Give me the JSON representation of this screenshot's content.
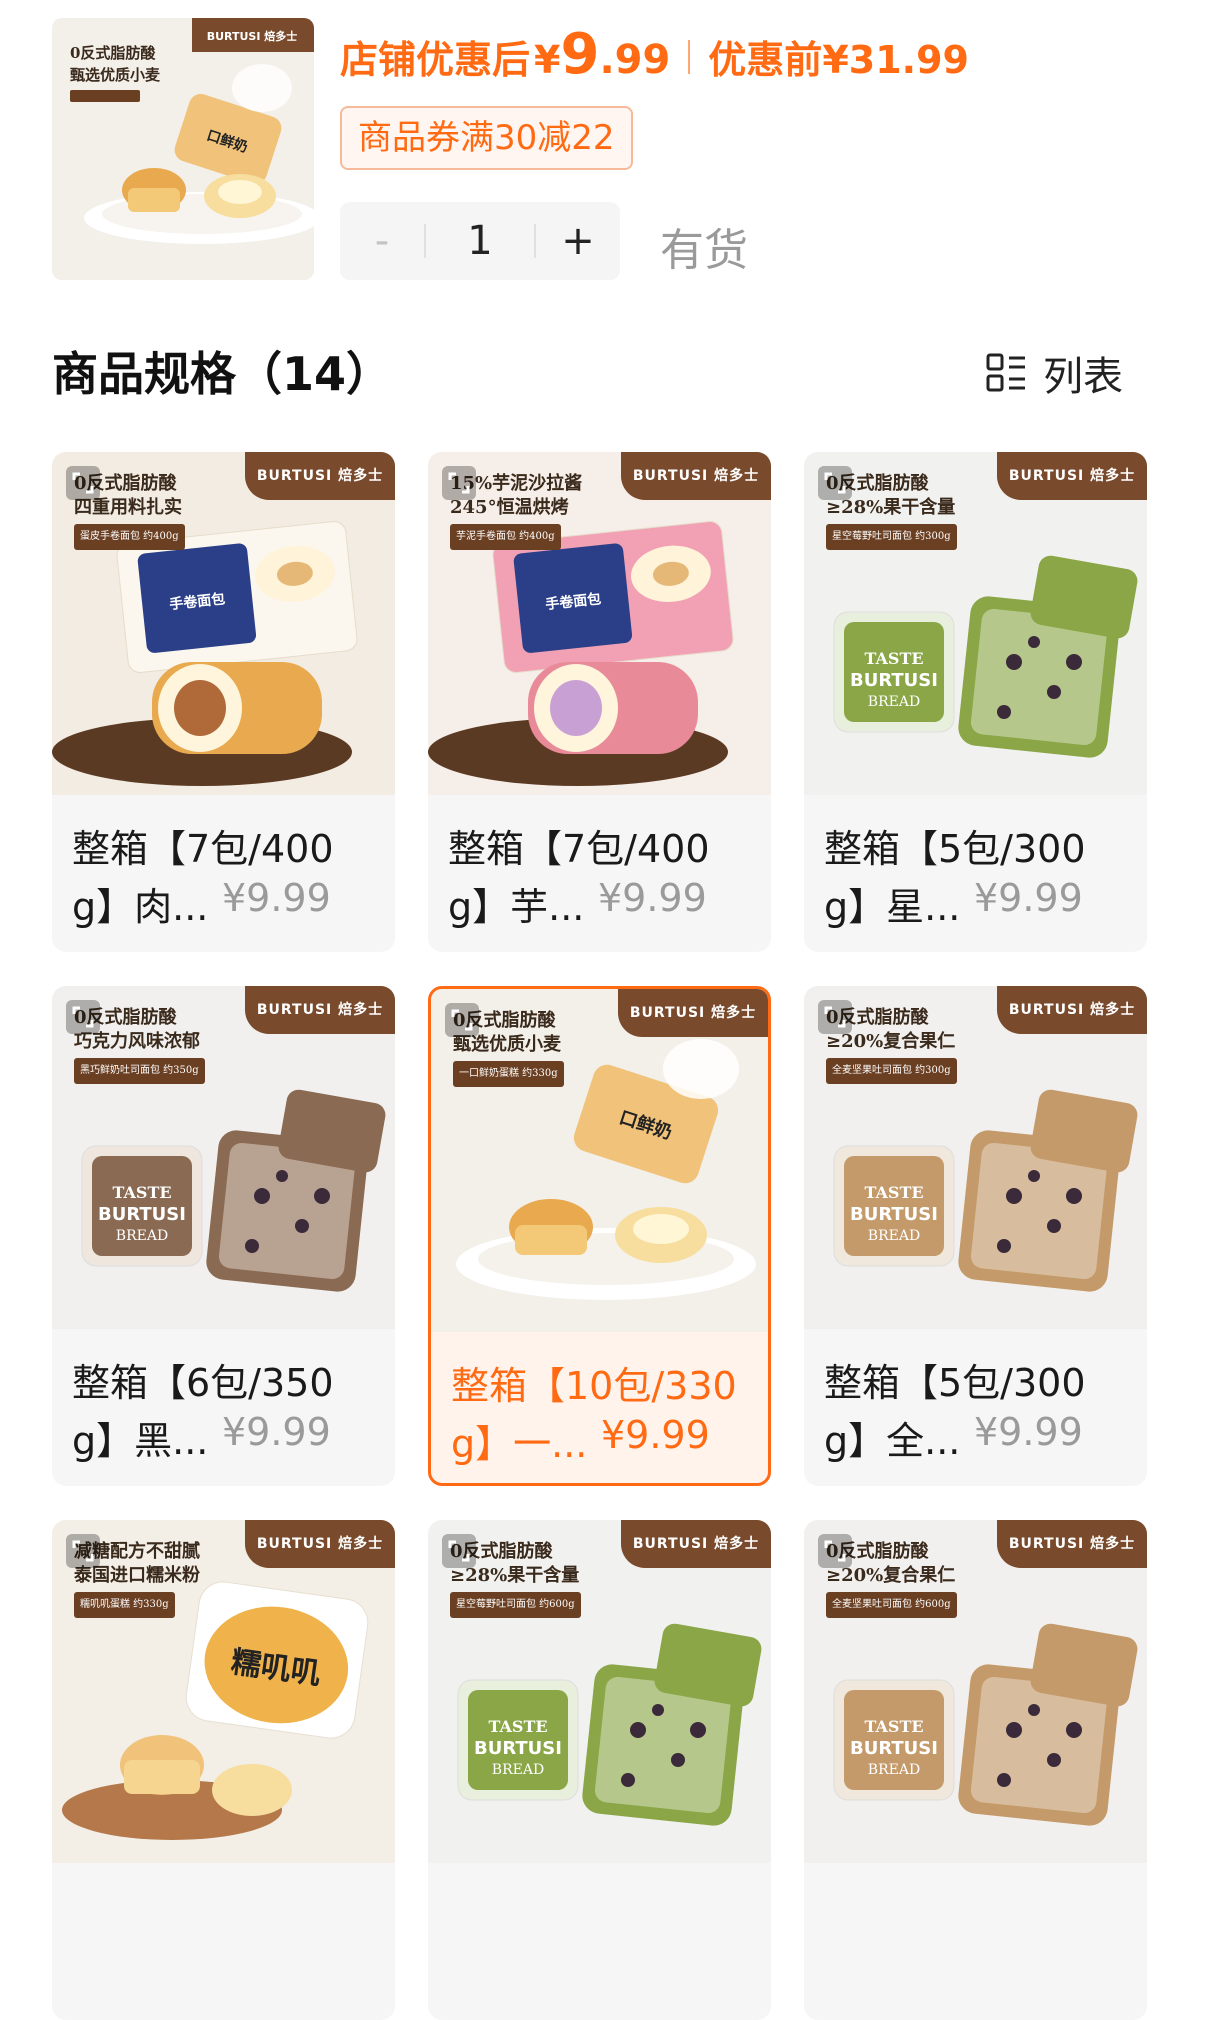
{
  "header": {
    "price_label": "店铺优惠后",
    "currency": "¥",
    "price_int": "9",
    "price_dec": ".99",
    "orig_label": "优惠前",
    "orig_price": "¥31.99",
    "coupon": "商品券满30减22",
    "qty_minus": "-",
    "qty_value": "1",
    "qty_plus": "+",
    "stock": "有货"
  },
  "section": {
    "title": "商品规格（14）",
    "view_label": "列表"
  },
  "brand": "BURTUSI 焙多士",
  "skus": [
    {
      "line1": "整箱【7包/400",
      "line2": "g】肉...",
      "price": "¥9.99",
      "tag1": "0反式脂肪酸",
      "tag2": "四重用料扎实",
      "tag3": "蛋皮手卷面包 约400g",
      "theme": "roll-yellow",
      "selected": false
    },
    {
      "line1": "整箱【7包/400",
      "line2": "g】芋...",
      "price": "¥9.99",
      "tag1": "15%芋泥沙拉酱",
      "tag2": "245°恒温烘烤",
      "tag3": "芋泥手卷面包 约400g",
      "theme": "roll-pink",
      "selected": false
    },
    {
      "line1": "整箱【5包/300",
      "line2": "g】星...",
      "price": "¥9.99",
      "tag1": "0反式脂肪酸",
      "tag2": "≥28%果干含量",
      "tag3": "星空莓野吐司面包 约300g",
      "theme": "toast-green",
      "selected": false
    },
    {
      "line1": "整箱【6包/350",
      "line2": "g】黑...",
      "price": "¥9.99",
      "tag1": "0反式脂肪酸",
      "tag2": "巧克力风味浓郁",
      "tag3": "黑巧鲜奶吐司面包 约350g",
      "theme": "toast-choc",
      "selected": false
    },
    {
      "line1": "整箱【10包/330",
      "line2": "g】一...",
      "price": "¥9.99",
      "tag1": "0反式脂肪酸",
      "tag2": "甄选优质小麦",
      "tag3": "一口鲜奶蛋糕 约330g",
      "theme": "cake-milk",
      "selected": true
    },
    {
      "line1": "整箱【5包/300",
      "line2": "g】全...",
      "price": "¥9.99",
      "tag1": "0反式脂肪酸",
      "tag2": "≥20%复合果仁",
      "tag3": "全麦坚果吐司面包 约300g",
      "theme": "toast-nut",
      "selected": false
    },
    {
      "line1": "",
      "line2": "",
      "price": "",
      "tag1": "减糖配方不甜腻",
      "tag2": "泰国进口糯米粉",
      "tag3": "糯叽叽蛋糕 约330g",
      "theme": "cake-nuo",
      "selected": false
    },
    {
      "line1": "",
      "line2": "",
      "price": "",
      "tag1": "0反式脂肪酸",
      "tag2": "≥28%果干含量",
      "tag3": "星空莓野吐司面包 约600g",
      "theme": "toast-green",
      "selected": false
    },
    {
      "line1": "",
      "line2": "",
      "price": "",
      "tag1": "0反式脂肪酸",
      "tag2": "≥20%复合果仁",
      "tag3": "全麦坚果吐司面包 约600g",
      "theme": "toast-nut",
      "selected": false
    }
  ],
  "colors": {
    "accent": "#ff6a13",
    "brand_badge": "#7a4a2c"
  },
  "icons": {
    "view": "list-view-icon",
    "expand": "expand-icon"
  }
}
